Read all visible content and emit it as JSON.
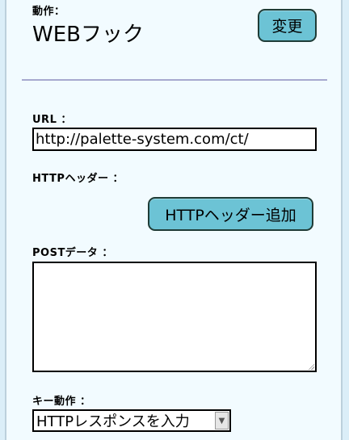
{
  "action": {
    "label": "動作：",
    "value": "WEBフック",
    "change_button": "変更"
  },
  "url": {
    "label": "URL ：",
    "value": "http://palette-system.com/ct/"
  },
  "http_header": {
    "label": "HTTPヘッダー ：",
    "add_button": "HTTPヘッダー追加"
  },
  "post_data": {
    "label": "POSTデータ ：",
    "value": ""
  },
  "key_action": {
    "label": "キー動作 ：",
    "selected": "HTTPレスポンスを入力"
  },
  "icons": {
    "select_arrow": "chevron-down-icon",
    "resize_grip": "resize-grip-icon"
  },
  "colors": {
    "background": "#f2fbff",
    "button": "#6cc3d5",
    "divider": "#a7a9cf"
  }
}
